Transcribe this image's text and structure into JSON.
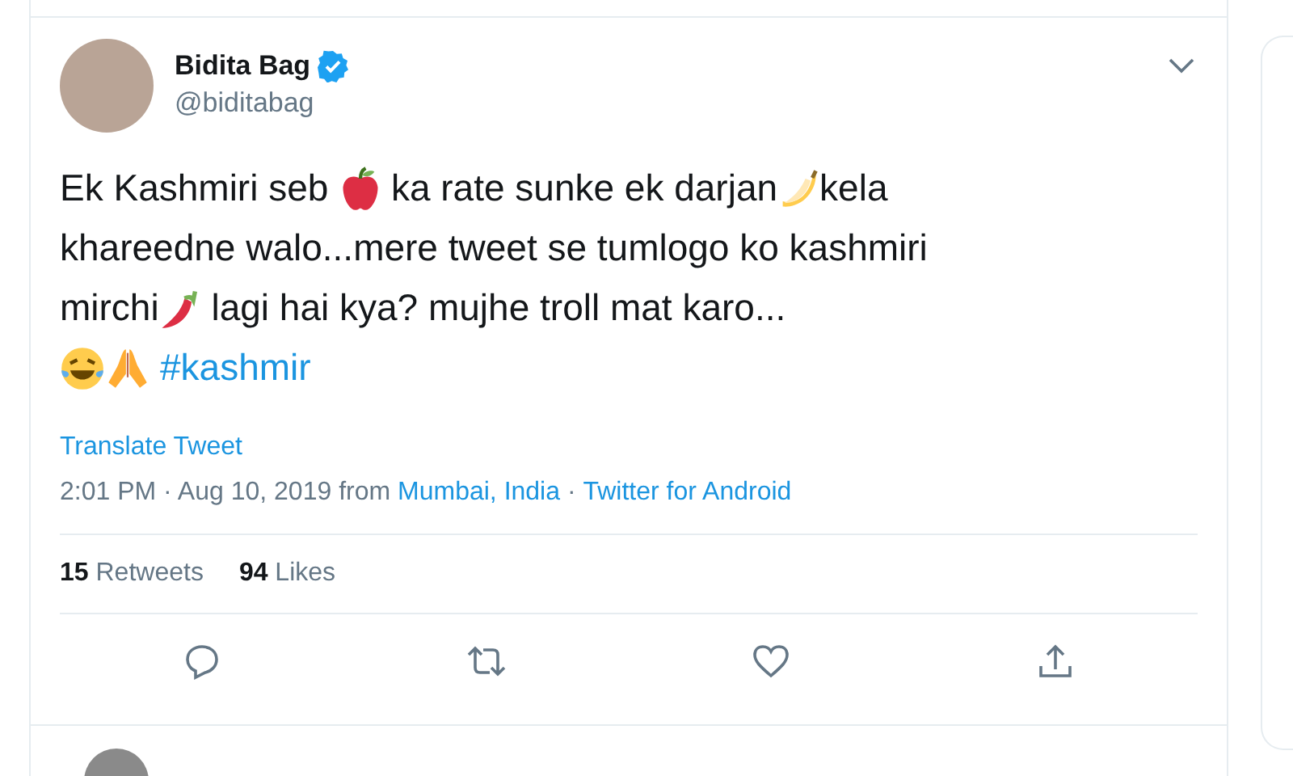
{
  "tweet": {
    "author": {
      "name": "Bidita Bag",
      "verified": true,
      "handle": "@biditabag"
    },
    "lines": [
      [
        {
          "kind": "text",
          "text": "Ek Kashmiri seb "
        },
        {
          "kind": "apple"
        },
        {
          "kind": "text",
          "text": " ka rate sunke ek darjan"
        },
        {
          "kind": "banana"
        },
        {
          "kind": "text",
          "text": "kela"
        }
      ],
      [
        {
          "kind": "text",
          "text": "khareedne walo...mere tweet se tumlogo ko kashmiri"
        }
      ],
      [
        {
          "kind": "text",
          "text": "mirchi"
        },
        {
          "kind": "chili"
        },
        {
          "kind": "text",
          "text": " lagi hai kya? mujhe troll mat karo..."
        }
      ],
      [
        {
          "kind": "laugh"
        },
        {
          "kind": "pray"
        },
        {
          "kind": "hashtag",
          "text": "#kashmir"
        }
      ]
    ],
    "translate": "Translate Tweet",
    "meta": {
      "time": "2:01 PM · Aug 10, 2019 from ",
      "location": "Mumbai, India",
      "sep": " · ",
      "source": "Twitter for Android"
    },
    "stats": [
      {
        "count": "15",
        "label": "Retweets"
      },
      {
        "count": "94",
        "label": "Likes"
      }
    ],
    "actions": [
      {
        "kind": "reply"
      },
      {
        "kind": "retweet"
      },
      {
        "kind": "like"
      },
      {
        "kind": "share"
      }
    ]
  }
}
